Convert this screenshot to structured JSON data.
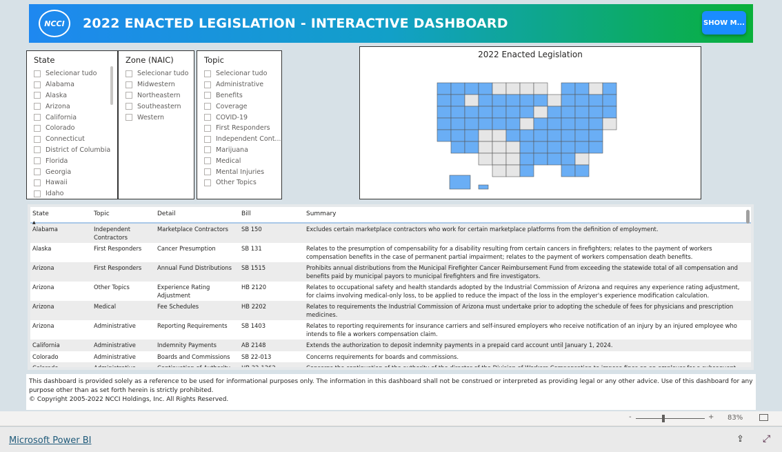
{
  "header": {
    "logo_text": "NCCI",
    "title": "2022 ENACTED LEGISLATION - INTERACTIVE DASHBOARD",
    "show_button": "SHOW M..."
  },
  "slicers": [
    {
      "title": "State",
      "options": [
        "Selecionar tudo",
        "Alabama",
        "Alaska",
        "Arizona",
        "California",
        "Colorado",
        "Connecticut",
        "District of Columbia",
        "Florida",
        "Georgia",
        "Hawaii",
        "Idaho"
      ]
    },
    {
      "title": "Zone (NAIC)",
      "options": [
        "Selecionar tudo",
        "Midwestern",
        "Northeastern",
        "Southeastern",
        "Western"
      ]
    },
    {
      "title": "Topic",
      "options": [
        "Selecionar tudo",
        "Administrative",
        "Benefits",
        "Coverage",
        "COVID-19",
        "First Responders",
        "Independent Cont...",
        "Marijuana",
        "Medical",
        "Mental Injuries",
        "Other Topics"
      ]
    }
  ],
  "map": {
    "title": "2022 Enacted Legislation",
    "colors": {
      "enacted": "#6aaef5",
      "none": "#e6e6e6"
    }
  },
  "table": {
    "columns": [
      "State",
      "Topic",
      "Detail",
      "Bill",
      "Summary"
    ],
    "rows": [
      [
        "Alabama",
        "Independent Contractors",
        "Marketplace Contractors",
        "SB 150",
        "Excludes certain marketplace contractors who work for certain marketplace platforms from the definition of employment."
      ],
      [
        "Alaska",
        "First Responders",
        "Cancer Presumption",
        "SB 131",
        "Relates to the presumption of compensability for a disability resulting from certain cancers in firefighters; relates to the payment of workers compensation benefits in the case of permanent partial impairment; relates to the payment of workers compensation death benefits."
      ],
      [
        "Arizona",
        "First Responders",
        "Annual Fund Distributions",
        "SB 1515",
        "Prohibits annual distributions from the Municipal Firefighter Cancer Reimbursement Fund from exceeding the statewide total of all compensation and benefits paid by municipal payors to municipal firefighters and fire investigators."
      ],
      [
        "Arizona",
        "Other Topics",
        "Experience Rating Adjustment",
        "HB 2120",
        "Relates to occupational safety and health standards adopted by the Industrial Commission of Arizona and requires any experience rating adjustment, for claims involving medical-only loss, to be applied to reduce the impact of the loss in the employer's experience modification calculation."
      ],
      [
        "Arizona",
        "Medical",
        "Fee Schedules",
        "HB 2202",
        "Relates to requirements the Industrial Commission of Arizona must undertake prior to adopting the schedule of fees for physicians and prescription medicines."
      ],
      [
        "Arizona",
        "Administrative",
        "Reporting Requirements",
        "SB 1403",
        "Relates to reporting requirements for insurance carriers and self-insured employers who receive notification of an injury by an injured employee who intends to file a workers compensation claim."
      ],
      [
        "California",
        "Administrative",
        "Indemnity Payments",
        "AB 2148",
        "Extends the authorization to deposit indemnity payments in a prepaid card account until January 1, 2024."
      ],
      [
        "Colorado",
        "Administrative",
        "Boards and Commissions",
        "SB 22-013",
        "Concerns requirements for boards and commissions."
      ],
      [
        "Colorado",
        "Administrative",
        "Continuation of Authority",
        "HB 22-1262",
        "Concerns the continuation of the authority of the director of the Division of Workers Compensation to impose fines on an employer for a subsequent failure to carry workers compensation insurance within a specified period after a previous failure."
      ]
    ]
  },
  "disclaimer": {
    "text": "This dashboard is provided solely as a reference to be used for informational purposes only.  The information in this dashboard shall not be construed or interpreted as providing legal or any other advice. Use of this dashboard for any purpose other than as set forth herein is strictly prohibited.",
    "copyright": "© Copyright 2005-2022 NCCI Holdings, Inc. All Rights Reserved."
  },
  "zoom": {
    "minus": "-",
    "plus": "+",
    "level": "83%"
  },
  "footer": {
    "link": "Microsoft Power BI"
  }
}
